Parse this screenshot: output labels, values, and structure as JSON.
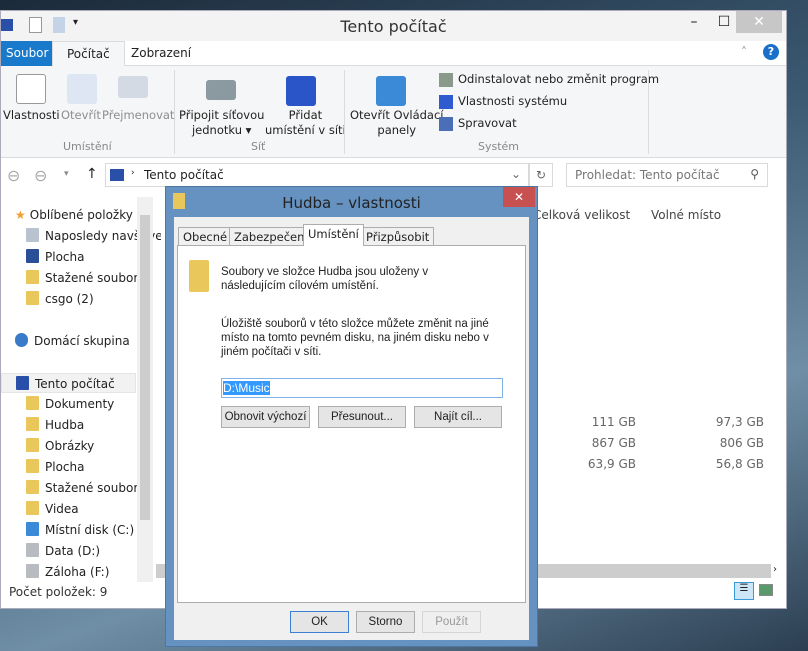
{
  "window": {
    "title": "Tento počítač",
    "minimize": "–",
    "maximize": "☐",
    "close": "✕"
  },
  "tabs": [
    "Soubor",
    "Počítač",
    "Zobrazení"
  ],
  "ribbon": {
    "umisteni": {
      "label": "Umístění",
      "items": [
        "Vlastnosti",
        "Otevřít",
        "Přejmenovat"
      ]
    },
    "sit": {
      "label": "Síť",
      "map_drive": [
        "Připojit síťovou",
        "jednotku ▾"
      ],
      "add_location": [
        "Přidat",
        "umístění v síti"
      ]
    },
    "system": {
      "label": "Systém",
      "control_panel": [
        "Otevřít Ovládací",
        "panely"
      ],
      "items": [
        "Odinstalovat nebo změnit program",
        "Vlastnosti systému",
        "Spravovat"
      ]
    }
  },
  "address": {
    "path": "Tento počítač",
    "search_placeholder": "Prohledat: Tento počítač"
  },
  "nav": {
    "favorites": {
      "label": "Oblíbené položky",
      "items": [
        "Naposledy navštívené",
        "Plocha",
        "Stažené soubory",
        "csgo (2)"
      ]
    },
    "homegroup": "Domácí skupina",
    "computer": {
      "label": "Tento počítač",
      "items": [
        "Dokumenty",
        "Hudba",
        "Obrázky",
        "Plocha",
        "Stažené soubory",
        "Videa",
        "Místní disk (C:)",
        "Data (D:)",
        "Záloha (F:)"
      ]
    }
  },
  "columns": [
    "Celková velikost",
    "Volné místo"
  ],
  "drives": [
    {
      "total": "111 GB",
      "free": "97,3 GB"
    },
    {
      "total": "867 GB",
      "free": "806 GB"
    },
    {
      "total": "63,9 GB",
      "free": "56,8 GB"
    }
  ],
  "status": "Počet položek: 9",
  "dialog": {
    "title": "Hudba – vlastnosti",
    "tabs": [
      "Obecné",
      "Zabezpečení",
      "Umístění",
      "Přizpůsobit"
    ],
    "active_tab": "Umístění",
    "text1": "Soubory ve složce Hudba jsou uloženy v následujícím cílovém umístění.",
    "text2": "Úložiště souborů v této složce můžete změnit na jiné místo na tomto pevném disku, na jiném disku nebo v jiném počítači v síti.",
    "path_value": "D:\\Music",
    "buttons": [
      "Obnovit výchozí",
      "Přesunout...",
      "Najít cíl..."
    ],
    "ok": "OK",
    "cancel": "Storno",
    "apply": "Použít"
  }
}
